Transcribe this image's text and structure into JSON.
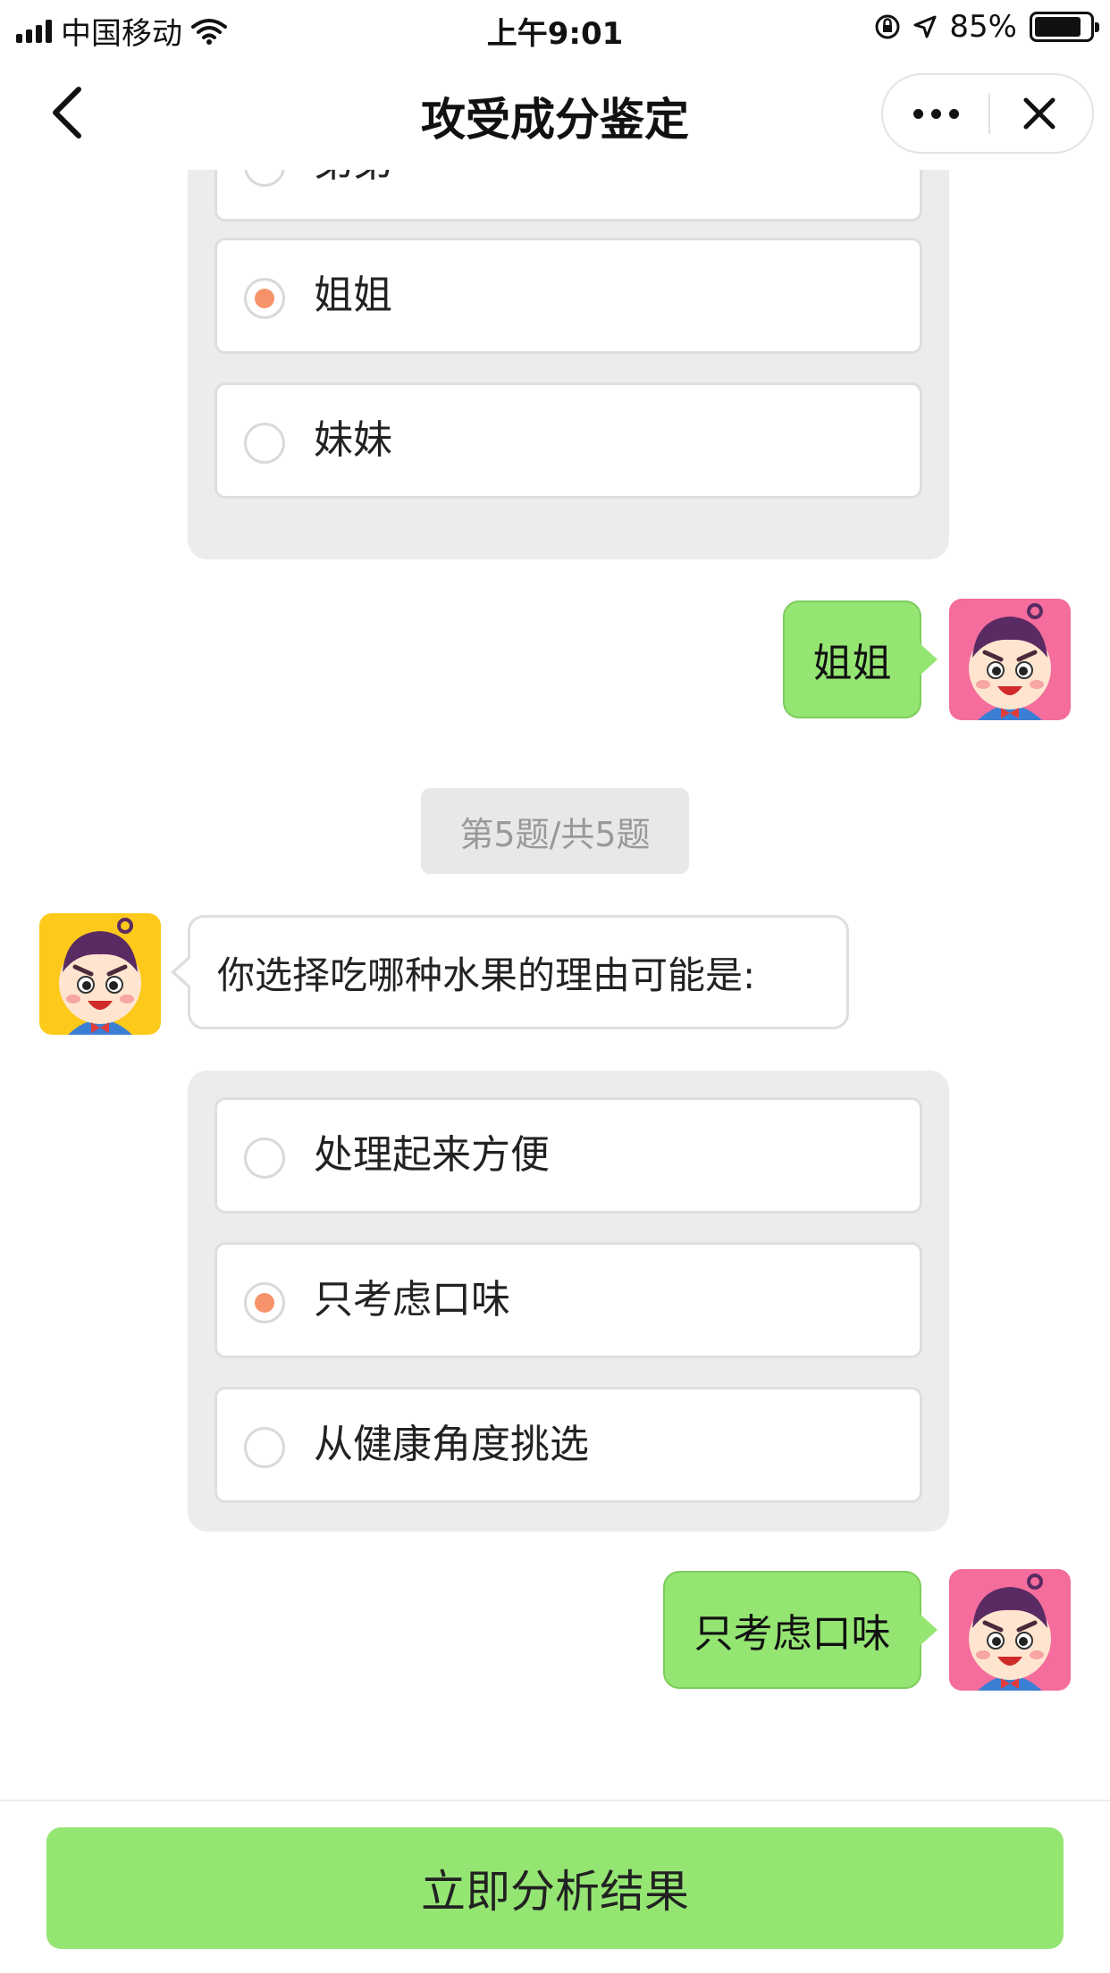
{
  "status_bar": {
    "carrier": "中国移动",
    "time": "上午9:01",
    "battery": "85%",
    "battery_level": 0.85
  },
  "nav": {
    "title": "攻受成分鉴定"
  },
  "question4": {
    "options": [
      {
        "label": "弟弟",
        "selected": false
      },
      {
        "label": "姐姐",
        "selected": true
      },
      {
        "label": "妹妹",
        "selected": false
      }
    ],
    "reply": "姐姐"
  },
  "question5": {
    "progress": "第5题/共5题",
    "text": "你选择吃哪种水果的理由可能是:",
    "options": [
      {
        "label": "处理起来方便",
        "selected": false
      },
      {
        "label": "只考虑口味",
        "selected": true
      },
      {
        "label": "从健康角度挑选",
        "selected": false
      }
    ],
    "reply": "只考虑口味"
  },
  "footer": {
    "button_label": "立即分析结果"
  },
  "colors": {
    "accent_green": "#95e573",
    "radio_selected": "#f7936a",
    "avatar_bot_bg": "#fdc91a",
    "avatar_user_bg": "#f46d9c"
  },
  "icons": {
    "back": "chevron-left-icon",
    "more": "more-dots-icon",
    "close": "close-icon",
    "wifi": "wifi-icon",
    "signal": "signal-icon",
    "location": "location-arrow-icon",
    "lock": "orientation-lock-icon",
    "battery": "battery-icon"
  }
}
